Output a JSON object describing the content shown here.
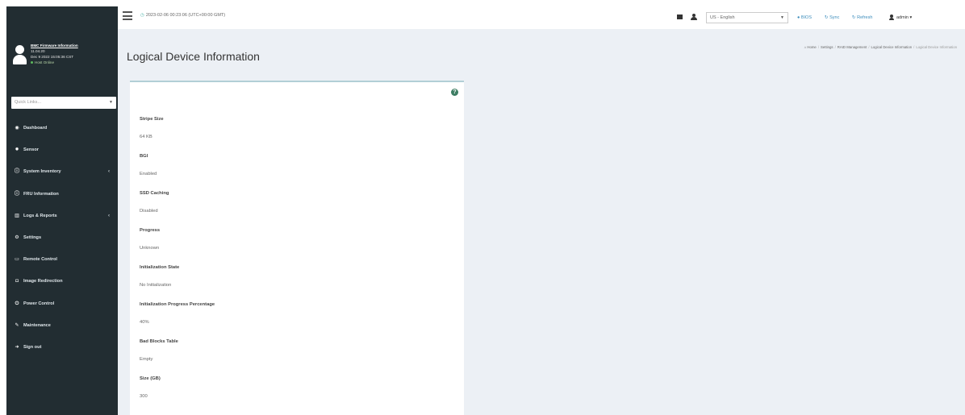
{
  "sidebar": {
    "profile": {
      "link": "BMC Firmware Information",
      "version": "11.04.20",
      "build_date": "Dec 9 2022 15:05:36 CST",
      "status": "Host Online"
    },
    "quick_links": {
      "placeholder": "Quick Links..."
    },
    "items": [
      {
        "icon": "tachometer-icon",
        "label": "Dashboard",
        "has_children": false
      },
      {
        "icon": "cogs-icon",
        "label": "Sensor",
        "has_children": false
      },
      {
        "icon": "info-circle-icon",
        "label": "System Inventory",
        "has_children": true
      },
      {
        "icon": "info-circle-icon",
        "label": "FRU Information",
        "has_children": false
      },
      {
        "icon": "bar-chart-icon",
        "label": "Logs & Reports",
        "has_children": true
      },
      {
        "icon": "gear-icon",
        "label": "Settings",
        "has_children": false
      },
      {
        "icon": "monitor-icon",
        "label": "Remote Control",
        "has_children": false
      },
      {
        "icon": "disk-icon",
        "label": "Image Redirection",
        "has_children": false
      },
      {
        "icon": "power-icon",
        "label": "Power Control",
        "has_children": false
      },
      {
        "icon": "wrench-icon",
        "label": "Maintenance",
        "has_children": false
      },
      {
        "icon": "sign-out-icon",
        "label": "Sign out",
        "has_children": false
      }
    ]
  },
  "topbar": {
    "datetime": "2023-02-06 00:23:06 (UTC+00:00 GMT)",
    "language": "US - English",
    "bios_label": "BIOS",
    "sync_label": "Sync",
    "refresh_label": "Refresh",
    "user_label": "admin"
  },
  "content": {
    "title": "Logical Device Information",
    "breadcrumb": [
      "Home",
      "Settings",
      "RAID Management",
      "Logical Device Information",
      "Logical Device Information"
    ],
    "fields": [
      {
        "label": "Stripe Size",
        "value": "64 KB"
      },
      {
        "label": "BGI",
        "value": "Enabled"
      },
      {
        "label": "SSD Caching",
        "value": "Disabled"
      },
      {
        "label": "Progress",
        "value": "Unknown"
      },
      {
        "label": "Initialization State",
        "value": "No Initialization"
      },
      {
        "label": "Initialization Progress Percentage",
        "value": "40%"
      },
      {
        "label": "Bad Blocks Table",
        "value": "Empty"
      },
      {
        "label": "Size (GB)",
        "value": "300"
      }
    ]
  },
  "colors": {
    "sidebar_bg": "#222d32",
    "accent": "#3c8dbc",
    "panel_border": "#b2cfd6",
    "help_icon": "#3d7d63",
    "content_bg": "#ecf0f5"
  }
}
